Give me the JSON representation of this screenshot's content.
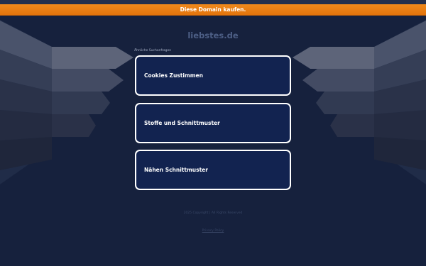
{
  "banner": {
    "label": "Diese Domain kaufen."
  },
  "domain": {
    "title": "liebstes.de"
  },
  "related": {
    "label": "Ähnliche Suchanfragen",
    "links": [
      {
        "label": "Cookies Zustimmen"
      },
      {
        "label": "Stoffe und Schnittmuster"
      },
      {
        "label": "Nähen Schnittmuster"
      }
    ]
  },
  "footer": {
    "copyright": "2025 Copyright | All Rights Reserved",
    "privacy_label": "Privacy Policy"
  },
  "colors": {
    "background": "#16213d",
    "banner": "#ef8a1c",
    "link_box": "#122350",
    "link_border": "#ffffff"
  }
}
